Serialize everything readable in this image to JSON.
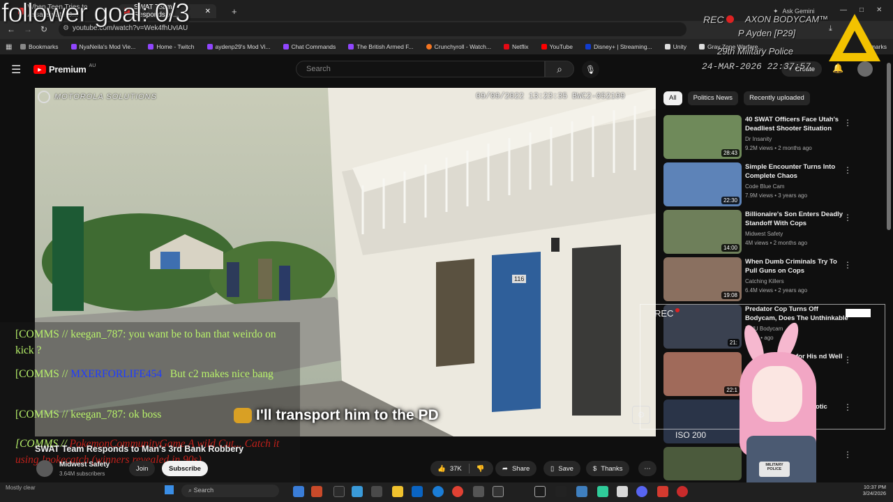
{
  "browser": {
    "tabs": [
      {
        "label": "When Teen Tries to Assassinate C..."
      },
      {
        "label": "SWAT Team Responds to..."
      }
    ],
    "new_tab": "+",
    "url": "youtube.com/watch?v=Wek4fhUvIAU",
    "gemini": "Ask Gemini",
    "all_bookmarks": "All Bookmarks",
    "bookmarks": [
      {
        "label": "Bookmarks",
        "color": "#888888"
      },
      {
        "label": "NyaNeila's Mod Vie...",
        "color": "#9146ff"
      },
      {
        "label": "Home - Twitch",
        "color": "#9146ff"
      },
      {
        "label": "aydenp29's Mod Vi...",
        "color": "#9146ff"
      },
      {
        "label": "Chat Commands",
        "color": "#9146ff"
      },
      {
        "label": "The British Armed F...",
        "color": "#9146ff"
      },
      {
        "label": "Crunchyroll - Watch...",
        "color": "#f47521"
      },
      {
        "label": "Netflix",
        "color": "#e50914"
      },
      {
        "label": "YouTube",
        "color": "#ff0000"
      },
      {
        "label": "Disney+ | Streaming...",
        "color": "#113ccf"
      },
      {
        "label": "Unity",
        "color": "#dddddd"
      },
      {
        "label": "Gray Zone Warfare...",
        "color": "#dddddd"
      }
    ]
  },
  "youtube": {
    "logo": "Premium",
    "region": "AU",
    "search_placeholder": "Search",
    "create": "Create",
    "chips": [
      "All",
      "Politics News",
      "Recently uploaded"
    ],
    "recommendations": [
      {
        "title": "40 SWAT Officers Face Utah's Deadliest Shooter Situation",
        "channel": "Dr Insanity",
        "views": "9.2M views • 2 months ago",
        "duration": "28:43",
        "thumb": "#6f8a5a"
      },
      {
        "title": "Simple Encounter Turns Into Complete Chaos",
        "channel": "Code Blue Cam",
        "views": "7.9M views • 3 years ago",
        "duration": "22:30",
        "thumb": "#5d83b8"
      },
      {
        "title": "Billionaire's Son Enters Deadly Standoff With Cops",
        "channel": "Midwest Safety",
        "views": "4M views • 2 months ago",
        "duration": "14:00",
        "thumb": "#6e7f5a"
      },
      {
        "title": "When Dumb Criminals Try To Pull Guns on Cops",
        "channel": "Catching Killers",
        "views": "6.4M views • 2 years ago",
        "duration": "19:08",
        "thumb": "#8a7060"
      },
      {
        "title": "Predator Cop Turns Off Bodycam, Does The Unthinkable",
        "channel": "EWU Bodycam",
        "views": "views • ago",
        "duration": "21:",
        "thumb": "#3a4150"
      },
      {
        "title": "for His nd Well",
        "channel": "",
        "views": "",
        "duration": "22:1",
        "thumb": "#a06a5a"
      },
      {
        "title": "Chaotic",
        "channel": "",
        "views": "",
        "duration": "",
        "thumb": "#2a3448"
      }
    ],
    "video_title": "SWAT Team Responds to Man's 3rd Bank Robbery",
    "channel_name": "Midwest Safety",
    "subscribers": "3.64M subscribers",
    "join": "Join",
    "subscribe": "Subscribe",
    "likes": "37K",
    "share": "Share",
    "save": "Save",
    "thanks": "Thanks"
  },
  "video": {
    "brand": "MOTOROLA SOLUTIONS",
    "timestamp": "09/09/2022 13:23:35 BWC2-052199",
    "door_number": "116",
    "caption": "I'll transport him to the PD"
  },
  "overlay": {
    "follower_goal": "follower goal: 0/3",
    "rec": "REC",
    "axon": "AXON BODYCAM™",
    "unit": "Ayden [P29]",
    "unit_prefix": "P",
    "mp": "29th Military Police",
    "datetime": "24-MAR-2026 22:37:57",
    "cam_rec": "REC",
    "iso": "ISO 200",
    "badge": "MILITARY POLICE"
  },
  "chat": [
    {
      "prefix": "[COMMS // ",
      "user": "keegan_787",
      "text": "you want be to ban that weirdo on kick ?",
      "user_style": "green"
    },
    {
      "prefix": "[COMMS // ",
      "user": "MXERFORLIFE454",
      "text": "But c2 makes nice bang",
      "user_style": "blue"
    },
    {
      "prefix": "[COMMS // ",
      "user": "keegan_787",
      "text": "ok boss",
      "user_style": "green"
    },
    {
      "prefix": "[COMMS // ",
      "user": "PokemonCommunityGame",
      "text": "A wild Cut... Catch it using !pokecatch (winners revealed in 90s)",
      "user_style": "red"
    }
  ],
  "taskbar": {
    "weather": "Mostly clear",
    "search": "Search",
    "time": "10:37 PM",
    "date": "3/24/2026"
  }
}
